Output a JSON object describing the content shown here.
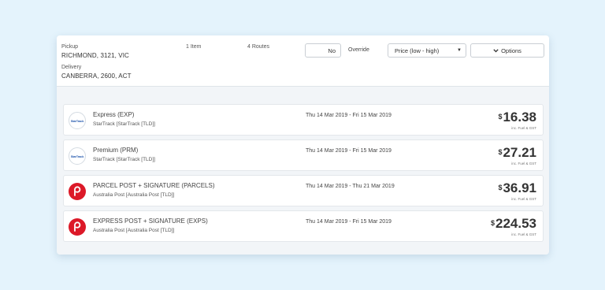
{
  "shipment": {
    "pickup_label": "Pickup",
    "pickup_value": "RICHMOND, 3121, VIC",
    "delivery_label": "Delivery",
    "delivery_value": "CANBERRA, 2600, ACT",
    "items_count": "1 Item",
    "routes_count": "4 Routes"
  },
  "controls": {
    "toggle_value": "No",
    "override_label": "Override",
    "sort_selected": "Price (low - high)",
    "options_label": "Options"
  },
  "routes": [
    {
      "service": "Express (EXP)",
      "carrier": "StarTrack [StarTrack [TLD]]",
      "dates": "Thu 14 Mar 2019 - Fri 15 Mar 2019",
      "currency": "$",
      "price": "16.38",
      "tax_note": "inc. Fuel & GST",
      "logo": "startrack-logo-icon"
    },
    {
      "service": "Premium (PRM)",
      "carrier": "StarTrack [StarTrack [TLD]]",
      "dates": "Thu 14 Mar 2019 - Fri 15 Mar 2019",
      "currency": "$",
      "price": "27.21",
      "tax_note": "inc. Fuel & GST",
      "logo": "startrack-logo-icon"
    },
    {
      "service": "PARCEL POST + SIGNATURE (PARCELS)",
      "carrier": "Australia Post [Australia Post [TLD]]",
      "dates": "Thu 14 Mar 2019 - Thu 21 Mar 2019",
      "currency": "$",
      "price": "36.91",
      "tax_note": "inc. Fuel & GST",
      "logo": "australia-post-logo-icon"
    },
    {
      "service": "EXPRESS POST + SIGNATURE (EXPS)",
      "carrier": "Australia Post [Australia Post [TLD]]",
      "dates": "Thu 14 Mar 2019 - Fri 15 Mar 2019",
      "currency": "$",
      "price": "224.53",
      "tax_note": "inc. Fuel & GST",
      "logo": "australia-post-logo-icon"
    }
  ],
  "colors": {
    "background": "#e4f3fc",
    "australia_post_red": "#dc1928",
    "startrack_blue": "#2a5db0"
  }
}
